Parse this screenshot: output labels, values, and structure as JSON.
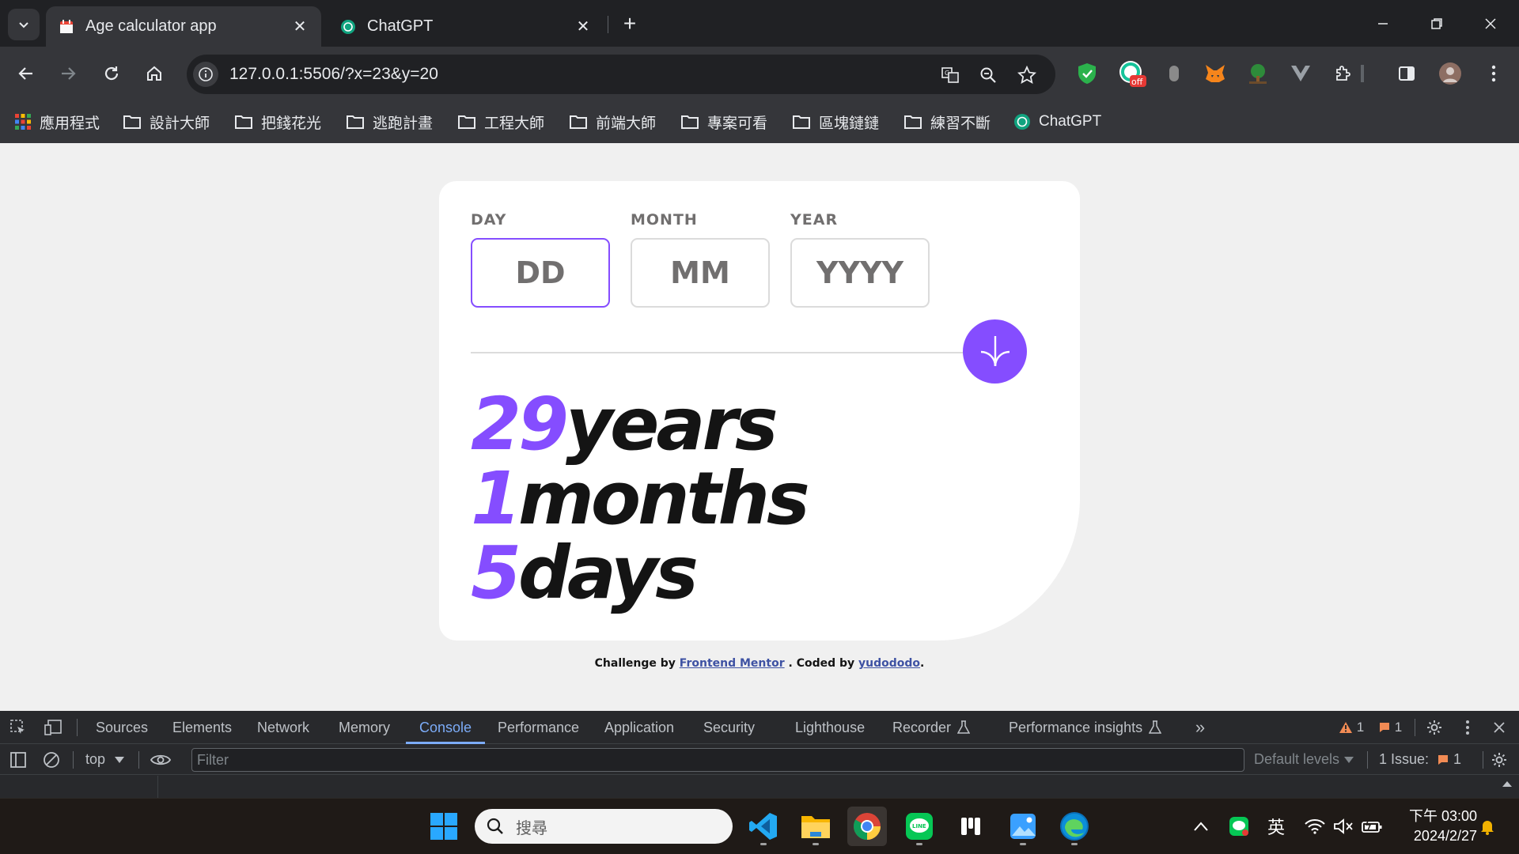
{
  "browser": {
    "tabs": [
      {
        "title": "Age calculator app",
        "active": true
      },
      {
        "title": "ChatGPT",
        "active": false
      }
    ],
    "url": "127.0.0.1:5506/?x=23&y=20",
    "bookmarks": [
      {
        "label": "應用程式",
        "icon": "apps-grid-icon"
      },
      {
        "label": "設計大師",
        "icon": "folder-icon"
      },
      {
        "label": "把錢花光",
        "icon": "folder-icon"
      },
      {
        "label": "逃跑計畫",
        "icon": "folder-icon"
      },
      {
        "label": "工程大師",
        "icon": "folder-icon"
      },
      {
        "label": "前端大師",
        "icon": "folder-icon"
      },
      {
        "label": "專案可看",
        "icon": "folder-icon"
      },
      {
        "label": "區塊鏈鏈",
        "icon": "folder-icon"
      },
      {
        "label": "練習不斷",
        "icon": "folder-icon"
      },
      {
        "label": "ChatGPT",
        "icon": "chatgpt-icon"
      }
    ],
    "extension_badge": "off"
  },
  "app": {
    "fields": [
      {
        "label": "DAY",
        "placeholder": "DD",
        "value": ""
      },
      {
        "label": "MONTH",
        "placeholder": "MM",
        "value": ""
      },
      {
        "label": "YEAR",
        "placeholder": "YYYY",
        "value": ""
      }
    ],
    "results": [
      {
        "value": "29",
        "unit": "years"
      },
      {
        "value": "1",
        "unit": "months"
      },
      {
        "value": "5",
        "unit": "days"
      }
    ],
    "attribution": {
      "prefix": "Challenge by",
      "link1": "Frontend Mentor",
      "middle": ". Coded by",
      "link2": "yudododo",
      "suffix": "."
    },
    "colors": {
      "accent": "#854dff",
      "text": "#141414",
      "muted": "#716f6f"
    }
  },
  "devtools": {
    "tabs": [
      "Sources",
      "Elements",
      "Network",
      "Memory",
      "Console",
      "Performance",
      "Application",
      "Security",
      "Lighthouse",
      "Recorder",
      "Performance insights"
    ],
    "active_tab": "Console",
    "warnings": "1",
    "errors": "1",
    "context": "top",
    "filter_placeholder": "Filter",
    "levels": "Default levels",
    "issues_label": "1 Issue:",
    "issues_count": "1"
  },
  "taskbar": {
    "search_placeholder": "搜尋",
    "ime": "英",
    "time": "下午 03:00",
    "date": "2024/2/27"
  }
}
